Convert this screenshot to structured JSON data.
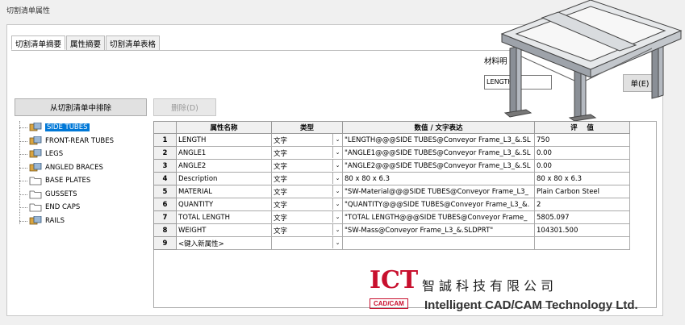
{
  "window": {
    "title": "切割清单属性"
  },
  "tabs": [
    {
      "label": "切割清单摘要",
      "active": true
    },
    {
      "label": "属性摘要",
      "active": false
    },
    {
      "label": "切割清单表格",
      "active": false
    }
  ],
  "buttons": {
    "exclude": "从切割清单中排除",
    "delete": "删除(D)",
    "material": "单(E)"
  },
  "material": {
    "label": "材料明",
    "value": "LENGTH"
  },
  "tree": [
    {
      "label": "SIDE TUBES",
      "icon": "weldment-icon",
      "selected": true
    },
    {
      "label": "FRONT-REAR TUBES",
      "icon": "weldment-icon",
      "selected": false
    },
    {
      "label": "LEGS",
      "icon": "weldment-icon",
      "selected": false
    },
    {
      "label": "ANGLED BRACES",
      "icon": "weldment-icon",
      "selected": false
    },
    {
      "label": "BASE PLATES",
      "icon": "folder-icon",
      "selected": false
    },
    {
      "label": "GUSSETS",
      "icon": "folder-icon",
      "selected": false
    },
    {
      "label": "END CAPS",
      "icon": "folder-icon",
      "selected": false
    },
    {
      "label": "RAILS",
      "icon": "weldment-icon",
      "selected": false
    }
  ],
  "grid": {
    "headers": [
      "属性名称",
      "类型",
      "数值 / 文字表达",
      "评",
      "值"
    ],
    "rows": [
      {
        "num": "1",
        "name": "LENGTH",
        "type": "文字",
        "expr": "\"LENGTH@@@SIDE TUBES@Conveyor Frame_L3_&.SL",
        "value": "750"
      },
      {
        "num": "2",
        "name": "ANGLE1",
        "type": "文字",
        "expr": "\"ANGLE1@@@SIDE TUBES@Conveyor Frame_L3_&.SL",
        "value": "0.00"
      },
      {
        "num": "3",
        "name": "ANGLE2",
        "type": "文字",
        "expr": "\"ANGLE2@@@SIDE TUBES@Conveyor Frame_L3_&.SL",
        "value": "0.00"
      },
      {
        "num": "4",
        "name": "Description",
        "type": "文字",
        "expr": "80 x 80 x 6.3",
        "value": "80 x 80 x 6.3"
      },
      {
        "num": "5",
        "name": "MATERIAL",
        "type": "文字",
        "expr": "\"SW-Material@@@SIDE TUBES@Conveyor Frame_L3_",
        "value": "Plain Carbon Steel"
      },
      {
        "num": "6",
        "name": "QUANTITY",
        "type": "文字",
        "expr": "\"QUANTITY@@@SIDE TUBES@Conveyor Frame_L3_&.",
        "value": "2"
      },
      {
        "num": "7",
        "name": "TOTAL LENGTH",
        "type": "文字",
        "expr": "\"TOTAL LENGTH@@@SIDE TUBES@Conveyor Frame_",
        "value": "5805.097"
      },
      {
        "num": "8",
        "name": "WEIGHT",
        "type": "文字",
        "expr": "\"SW-Mass@Conveyor Frame_L3_&.SLDPRT\"",
        "value": "104301.500"
      },
      {
        "num": "9",
        "name": "<键入新属性>",
        "type": "",
        "expr": "",
        "value": ""
      }
    ]
  },
  "watermark": {
    "logo": "ICT",
    "sub": "CAD/CAM",
    "cn": "智誠科技有限公司",
    "en": "Intelligent CAD/CAM Technology Ltd."
  },
  "colors": {
    "selection": "#0078d7",
    "brand": "#c8102e"
  }
}
